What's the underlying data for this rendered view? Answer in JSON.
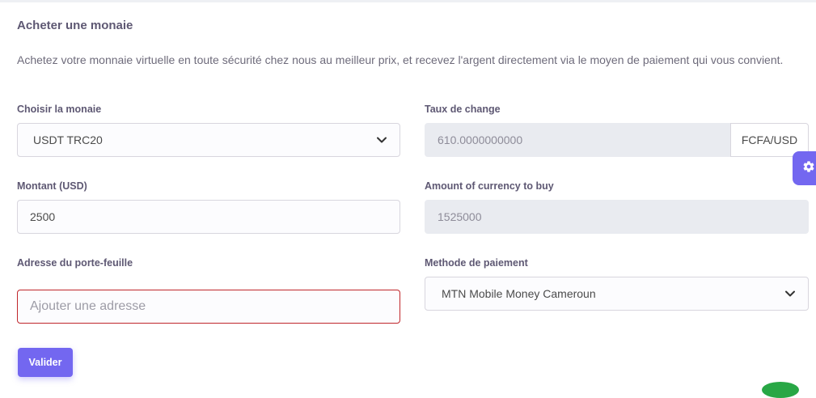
{
  "card": {
    "title": "Acheter une monaie",
    "description": "Achetez votre monnaie virtuelle en toute sécurité chez nous au meilleur prix, et recevez l'argent directement via le moyen de paiement qui vous convient."
  },
  "form": {
    "currency": {
      "label": "Choisir la monaie",
      "value": "USDT TRC20"
    },
    "exchange_rate": {
      "label": "Taux de change",
      "value": "610.0000000000",
      "unit": "FCFA/USD"
    },
    "amount": {
      "label": "Montant (USD)",
      "value": "2500"
    },
    "amount_to_buy": {
      "label": "Amount of currency to buy",
      "value": "1525000"
    },
    "wallet_address": {
      "label": "Adresse du porte-feuille",
      "placeholder": "Ajouter une adresse"
    },
    "payment_method": {
      "label": "Methode de paiement",
      "value": "MTN Mobile Money Cameroun"
    },
    "submit_label": "Valider"
  },
  "icons": {
    "settings": "gear-icon",
    "dropdown": "chevron-down-icon"
  },
  "colors": {
    "primary": "#7367f0",
    "error": "#c0262b",
    "disabled_bg": "#e9ebf0"
  }
}
